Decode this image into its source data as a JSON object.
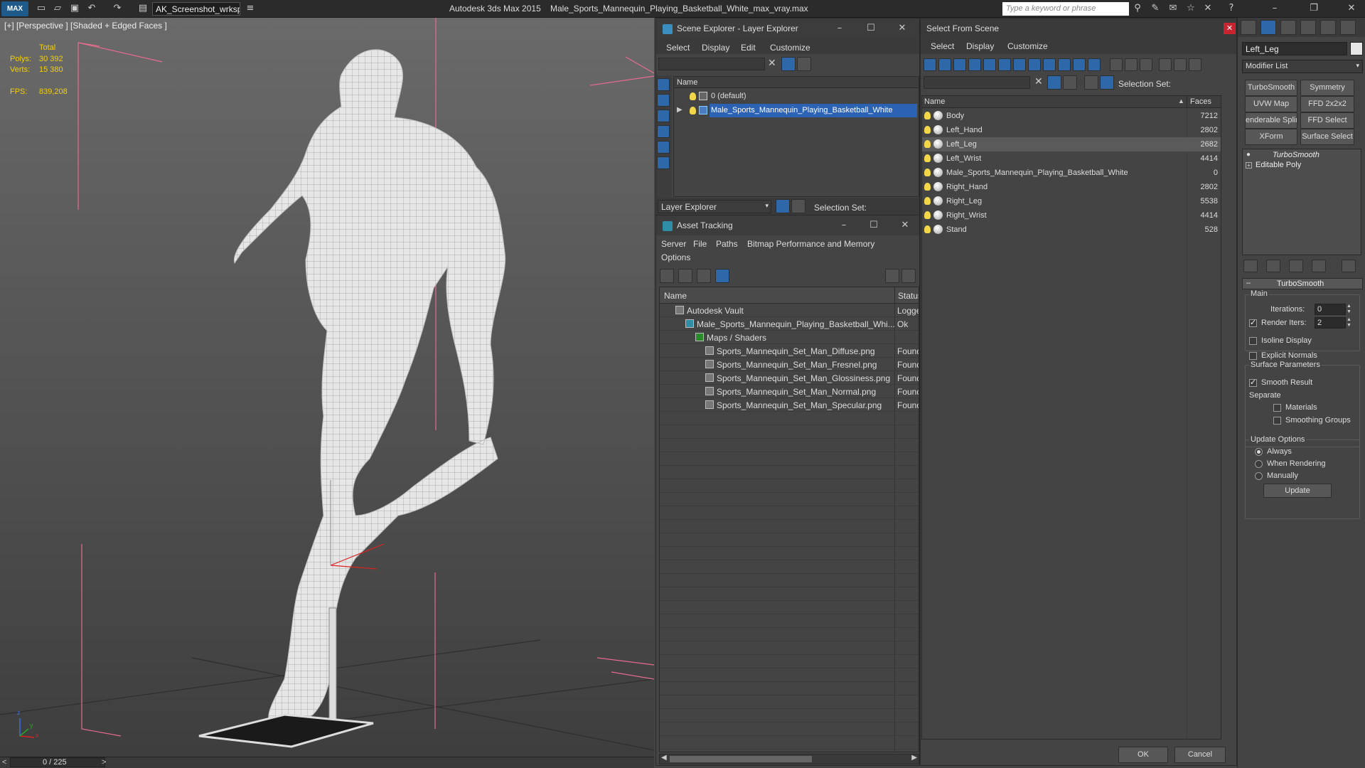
{
  "titlebar": {
    "app_icon": "MAX",
    "workspace": "AK_Screenshot_wrksp",
    "app_title": "Autodesk 3ds Max  2015",
    "file_title": "Male_Sports_Mannequin_Playing_Basketball_White_max_vray.max",
    "search_placeholder": "Type a keyword or phrase",
    "icons": [
      "new-file-icon",
      "open-icon",
      "save-icon",
      "undo-icon",
      "redo-icon",
      "project-icon",
      "binoculars-icon",
      "tools-icon",
      "communication-icon",
      "star-icon",
      "exchange-icon",
      "help-icon",
      "minimize-icon",
      "restore-icon",
      "close-icon"
    ]
  },
  "viewport": {
    "label": "[+] [Perspective ] [Shaded + Edged Faces ]",
    "stats": {
      "total_label": "Total",
      "polys_label": "Polys:",
      "polys_value": "30 392",
      "verts_label": "Verts:",
      "verts_value": "15 380",
      "fps_label": "FPS:",
      "fps_value": "839,208"
    },
    "axis_labels": {
      "x": "x",
      "y": "y",
      "z": "z"
    },
    "colors": {
      "stat": "#f5d000",
      "bound": "#e46c8d"
    }
  },
  "timeline": {
    "frame": "0 / 225",
    "prev": "<",
    "next": ">"
  },
  "scene_explorer": {
    "title": "Scene Explorer - Layer Explorer",
    "menus": [
      "Select",
      "Display",
      "Edit",
      "Customize"
    ],
    "column_name": "Name",
    "rows": [
      {
        "label": "0 (default)",
        "selected": false
      },
      {
        "label": "Male_Sports_Mannequin_Playing_Basketball_White",
        "selected": true
      }
    ],
    "footer_dropdown": "Layer Explorer",
    "selection_set_label": "Selection Set:"
  },
  "asset_tracking": {
    "title": "Asset Tracking",
    "menus": [
      "Server",
      "File",
      "Paths",
      "Bitmap Performance and Memory",
      "Options"
    ],
    "columns": [
      "Name",
      "Status"
    ],
    "rows": [
      {
        "name": "Autodesk Vault",
        "status": "Logge",
        "indent": 0
      },
      {
        "name": "Male_Sports_Mannequin_Playing_Basketball_Whi...",
        "status": "Ok",
        "indent": 1
      },
      {
        "name": "Maps / Shaders",
        "status": "",
        "indent": 2
      },
      {
        "name": "Sports_Mannequin_Set_Man_Diffuse.png",
        "status": "Found",
        "indent": 3
      },
      {
        "name": "Sports_Mannequin_Set_Man_Fresnel.png",
        "status": "Found",
        "indent": 3
      },
      {
        "name": "Sports_Mannequin_Set_Man_Glossiness.png",
        "status": "Found",
        "indent": 3
      },
      {
        "name": "Sports_Mannequin_Set_Man_Normal.png",
        "status": "Found",
        "indent": 3
      },
      {
        "name": "Sports_Mannequin_Set_Man_Specular.png",
        "status": "Found",
        "indent": 3
      }
    ]
  },
  "select_from_scene": {
    "title": "Select From Scene",
    "menus": [
      "Select",
      "Display",
      "Customize"
    ],
    "selection_set_label": "Selection Set:",
    "columns": [
      "Name",
      "Faces"
    ],
    "rows": [
      {
        "name": "Body",
        "faces": "7212",
        "selected": false
      },
      {
        "name": "Left_Hand",
        "faces": "2802",
        "selected": false
      },
      {
        "name": "Left_Leg",
        "faces": "2682",
        "selected": true
      },
      {
        "name": "Left_Wrist",
        "faces": "4414",
        "selected": false
      },
      {
        "name": "Male_Sports_Mannequin_Playing_Basketball_White",
        "faces": "0",
        "selected": false
      },
      {
        "name": "Right_Hand",
        "faces": "2802",
        "selected": false
      },
      {
        "name": "Right_Leg",
        "faces": "5538",
        "selected": false
      },
      {
        "name": "Right_Wrist",
        "faces": "4414",
        "selected": false
      },
      {
        "name": "Stand",
        "faces": "528",
        "selected": false
      }
    ],
    "ok": "OK",
    "cancel": "Cancel"
  },
  "command_panel": {
    "object_name": "Left_Leg",
    "modifier_list": "Modifier List",
    "mod_buttons": [
      "TurboSmooth",
      "Symmetry",
      "UVW Map",
      "FFD 2x2x2",
      "enderable Splin",
      "FFD Select",
      "XForm",
      "Surface Select"
    ],
    "stack": [
      "TurboSmooth",
      "Editable Poly"
    ],
    "rollout_title": "TurboSmooth",
    "main_label": "Main",
    "iterations_label": "Iterations:",
    "iterations_value": "0",
    "render_iters_label": "Render Iters:",
    "render_iters_value": "2",
    "render_iters_checked": true,
    "isoline": "Isoline Display",
    "explicit_normals": "Explicit Normals",
    "surface_params": "Surface Parameters",
    "smooth_result": "Smooth Result",
    "separate": "Separate",
    "materials": "Materials",
    "smoothing_groups": "Smoothing Groups",
    "update_options": "Update Options",
    "always": "Always",
    "when_rendering": "When Rendering",
    "manually": "Manually",
    "update_button": "Update"
  }
}
